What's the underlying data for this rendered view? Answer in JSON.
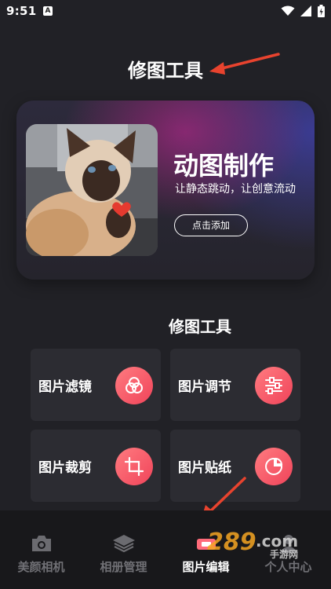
{
  "status_bar": {
    "time": "9:51",
    "notification_badge": "A",
    "icons": [
      "wifi-icon",
      "signal-icon",
      "battery-icon"
    ]
  },
  "header": {
    "title": "修图工具"
  },
  "banner": {
    "title": "动图制作",
    "subtitle": "让静态跳动，让创意流动",
    "add_button_label": "点击添加",
    "image": "cat-photo"
  },
  "tools_section": {
    "title": "修图工具",
    "items": [
      {
        "label": "图片滤镜",
        "icon": "filter-icon"
      },
      {
        "label": "图片调节",
        "icon": "adjust-sliders-icon"
      },
      {
        "label": "图片裁剪",
        "icon": "crop-icon"
      },
      {
        "label": "图片贴纸",
        "icon": "sticker-icon"
      }
    ]
  },
  "bottom_nav": {
    "items": [
      {
        "label": "美颜相机",
        "icon": "camera-icon",
        "active": false
      },
      {
        "label": "相册管理",
        "icon": "layers-icon",
        "active": false
      },
      {
        "label": "图片编辑",
        "icon": "edit-icon",
        "active": true
      },
      {
        "label": "个人中心",
        "icon": "person-icon",
        "active": false
      }
    ]
  },
  "colors": {
    "background": "#212126",
    "card": "#2c2c32",
    "accent_gradient_start": "#ff7b80",
    "accent_gradient_end": "#f0445a",
    "arrow": "#e8432e",
    "nav_inactive": "#707075"
  },
  "watermark": "289.com 手游网"
}
